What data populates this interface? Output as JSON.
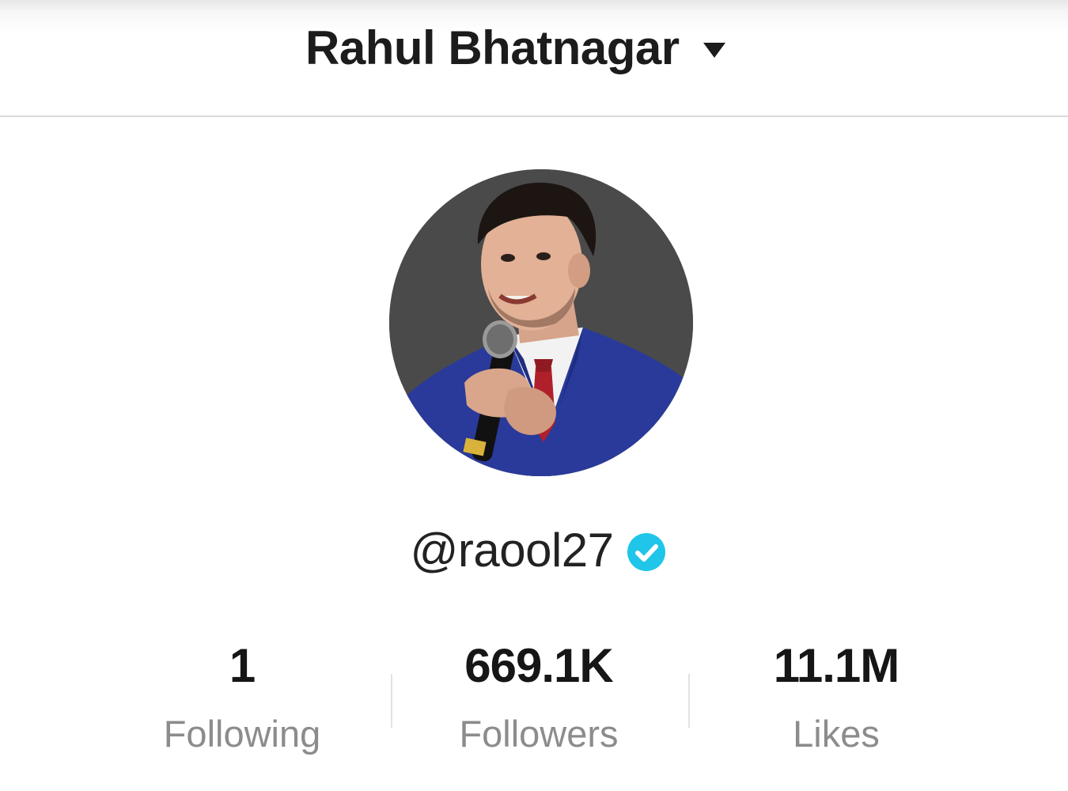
{
  "header": {
    "title": "Rahul Bhatnagar"
  },
  "profile": {
    "handle": "@raool27"
  },
  "stats": [
    {
      "value": "1",
      "label": "Following"
    },
    {
      "value": "669.1K",
      "label": "Followers"
    },
    {
      "value": "11.1M",
      "label": "Likes"
    }
  ],
  "colors": {
    "verified_badge": "#20c5ea",
    "suit": "#2a3a9a",
    "tie": "#b0202a"
  }
}
